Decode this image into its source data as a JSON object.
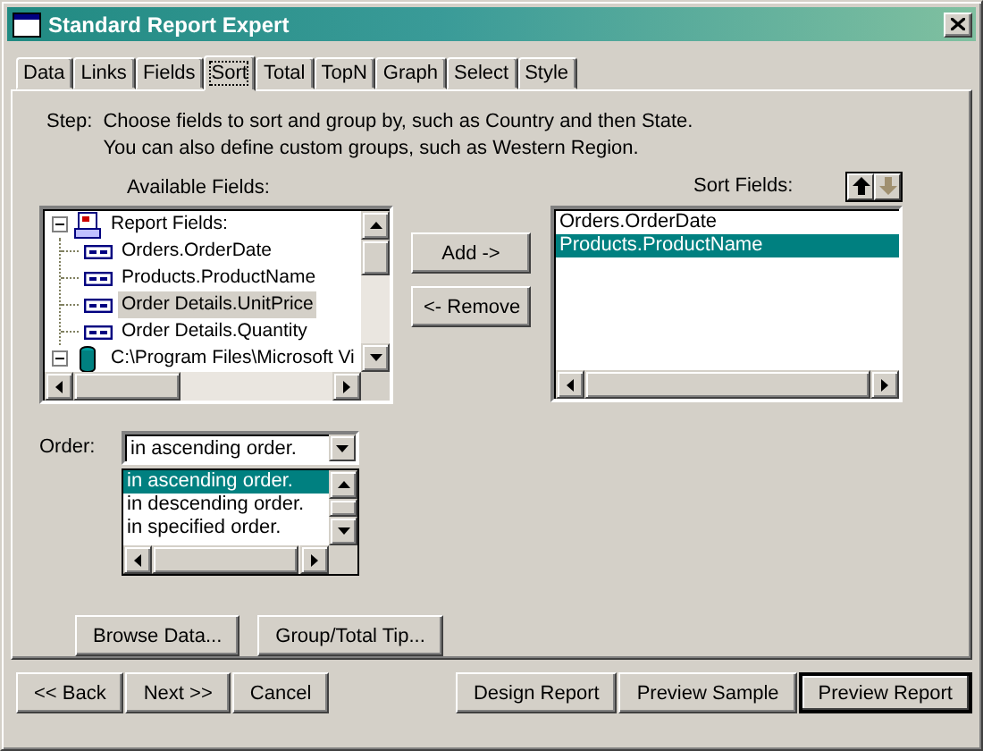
{
  "window": {
    "title": "Standard Report Expert"
  },
  "tabs": [
    {
      "label": "Data",
      "selected": false
    },
    {
      "label": "Links",
      "selected": false
    },
    {
      "label": "Fields",
      "selected": false
    },
    {
      "label": "Sort",
      "selected": true
    },
    {
      "label": "Total",
      "selected": false
    },
    {
      "label": "TopN",
      "selected": false
    },
    {
      "label": "Graph",
      "selected": false
    },
    {
      "label": "Select",
      "selected": false
    },
    {
      "label": "Style",
      "selected": false
    }
  ],
  "step": {
    "label": "Step:",
    "lines": [
      "Choose fields to sort and group by, such as Country and then State.",
      "You can also define custom groups, such as Western Region."
    ]
  },
  "available_fields": {
    "label": "Available Fields:",
    "tree": [
      {
        "label": "Report Fields:",
        "kind": "report",
        "expanded": true,
        "selected": false,
        "children": [
          {
            "label": "Orders.OrderDate",
            "kind": "field",
            "selected": false
          },
          {
            "label": "Products.ProductName",
            "kind": "field",
            "selected": false
          },
          {
            "label": "Order Details.UnitPrice",
            "kind": "field",
            "selected": true
          },
          {
            "label": "Order Details.Quantity",
            "kind": "field",
            "selected": false
          }
        ]
      },
      {
        "label": "C:\\Program Files\\Microsoft Vi",
        "kind": "database",
        "expanded": true,
        "selected": false
      }
    ]
  },
  "transfer_buttons": [
    "Add ->",
    "<- Remove"
  ],
  "sort_fields": {
    "label": "Sort Fields:",
    "move_up_disabled": false,
    "move_down_disabled": true,
    "items": [
      {
        "label": "Orders.OrderDate",
        "selected": false
      },
      {
        "label": "Products.ProductName",
        "selected": true
      }
    ]
  },
  "order": {
    "label": "Order:",
    "value": "in ascending order.",
    "options": [
      {
        "label": "in ascending order.",
        "selected": true
      },
      {
        "label": "in descending order.",
        "selected": false
      },
      {
        "label": "in specified order.",
        "selected": false
      }
    ]
  },
  "action_buttons": [
    "Browse Data...",
    "Group/Total Tip..."
  ],
  "nav_buttons": [
    {
      "label": "<< Back",
      "default": false
    },
    {
      "label": "Next >>",
      "default": false
    },
    {
      "label": "Cancel",
      "default": false
    }
  ],
  "report_buttons": [
    {
      "label": "Design Report",
      "default": false
    },
    {
      "label": "Preview Sample",
      "default": false
    },
    {
      "label": "Preview Report",
      "default": true
    }
  ]
}
